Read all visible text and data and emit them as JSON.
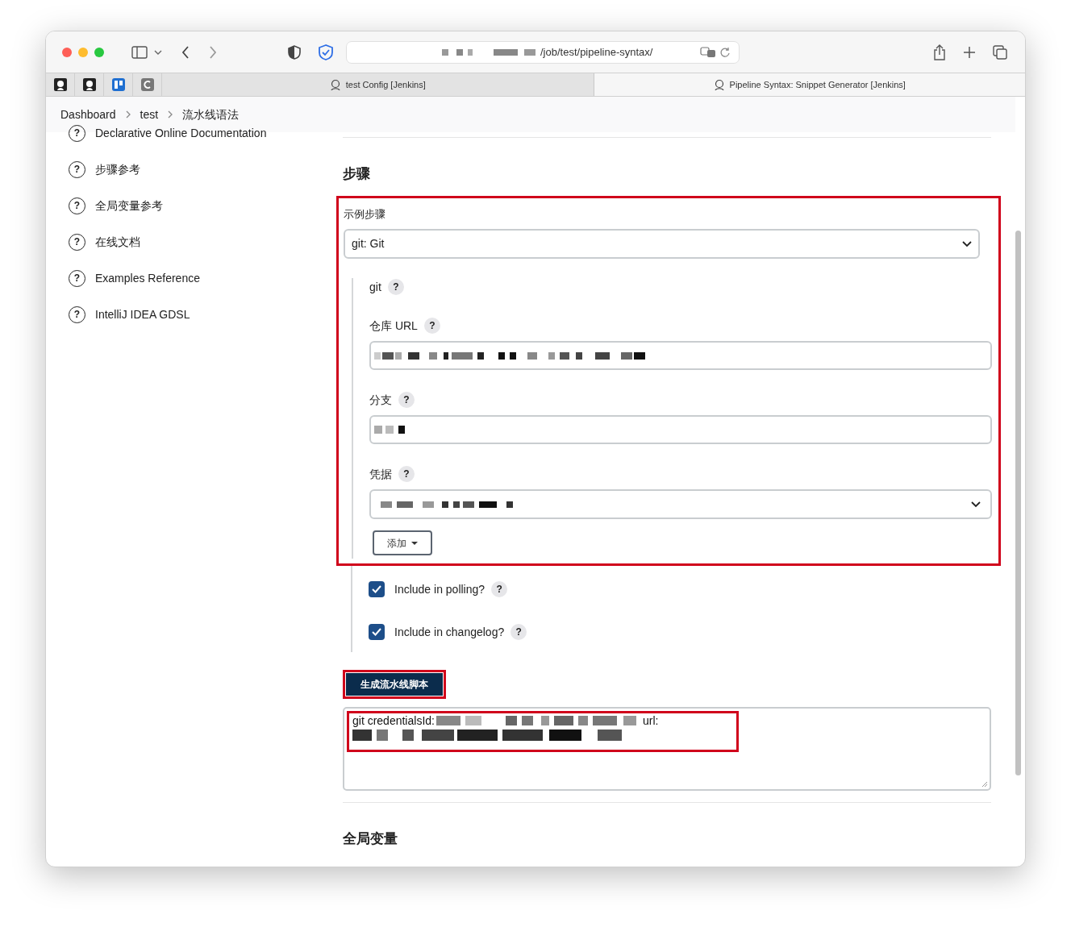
{
  "browser": {
    "url": "/job/test/pipeline-syntax/",
    "tabs": [
      {
        "label": "test Config [Jenkins]",
        "selected": false
      },
      {
        "label": "Pipeline Syntax: Snippet Generator [Jenkins]",
        "selected": true
      }
    ]
  },
  "breadcrumb": [
    "Dashboard",
    "test",
    "流水线语法"
  ],
  "sidebar": {
    "items": [
      {
        "icon": "?",
        "label": "Declarative Online Documentation"
      },
      {
        "icon": "?",
        "label": "步骤参考"
      },
      {
        "icon": "?",
        "label": "全局变量参考"
      },
      {
        "icon": "?",
        "label": "在线文档"
      },
      {
        "icon": "?",
        "label": "Examples Reference"
      },
      {
        "icon": "?",
        "label": "IntelliJ IDEA GDSL"
      }
    ]
  },
  "steps": {
    "heading": "步骤",
    "sample_label": "示例步骤",
    "sample_value": "git: Git",
    "section_title": "git",
    "section_help": "?",
    "fields": [
      {
        "label": "仓库 URL",
        "help": "?",
        "kind": "text"
      },
      {
        "label": "分支",
        "help": "?",
        "kind": "text"
      },
      {
        "label": "凭据",
        "help": "?",
        "kind": "select"
      }
    ],
    "add_button": "添加",
    "checkboxes": [
      {
        "label": "Include in polling?",
        "help": "?",
        "checked": true
      },
      {
        "label": "Include in changelog?",
        "help": "?",
        "checked": true
      }
    ]
  },
  "generate_button": "生成流水线脚本",
  "output": {
    "prefix": "git credentialsId:",
    "middle": "url:"
  },
  "global_heading": "全局变量"
}
